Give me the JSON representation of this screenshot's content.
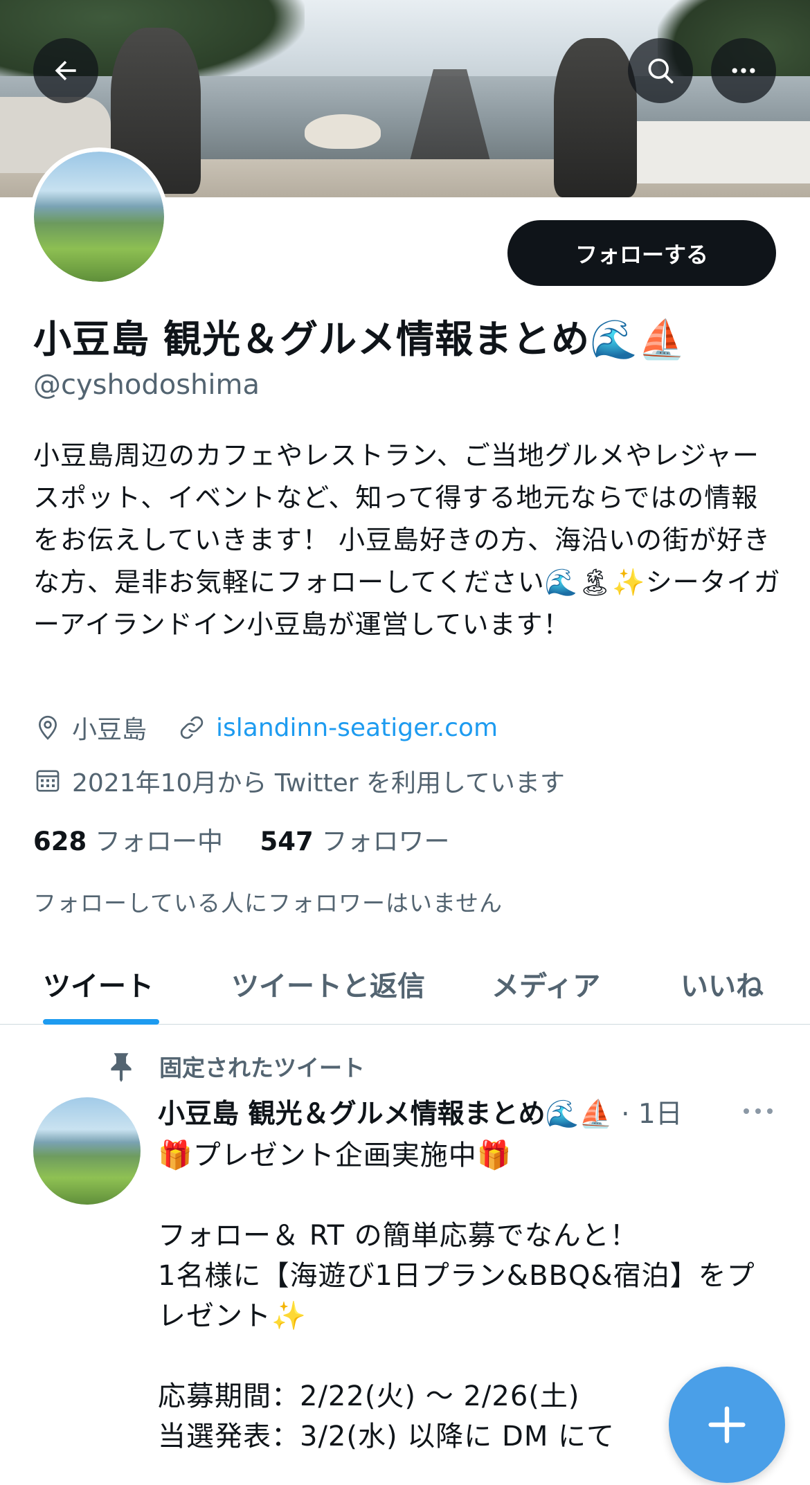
{
  "header": {
    "back_icon": "arrow-left-icon",
    "search_icon": "search-icon",
    "more_icon": "more-horizontal-icon"
  },
  "profile": {
    "follow_label": "フォローする",
    "display_name": "小豆島 観光＆グルメ情報まとめ🌊⛵",
    "handle": "@cyshodoshima",
    "bio": "小豆島周辺のカフェやレストラン、ご当地グルメやレジャースポット、イベントなど、知って得する地元ならではの情報をお伝えしていきます！ 小豆島好きの方、海沿いの街が好きな方、是非お気軽にフォローしてください🌊🏝✨シータイガーアイランドイン小豆島が運営しています！",
    "location": "小豆島",
    "website": "islandinn-seatiger.com",
    "joined": "2021年10月から Twitter を利用しています",
    "following_count": "628",
    "following_label": "フォロー中",
    "followers_count": "547",
    "followers_label": "フォロワー",
    "no_mutual_followers": "フォローしている人にフォロワーはいません"
  },
  "tabs": [
    {
      "label": "ツイート",
      "active": true
    },
    {
      "label": "ツイートと返信",
      "active": false
    },
    {
      "label": "メディア",
      "active": false
    },
    {
      "label": "いいね",
      "active": false
    }
  ],
  "pinned_tweet": {
    "pinned_label": "固定されたツイート",
    "author": "小豆島 観光＆グルメ情報まとめ🌊⛵",
    "time": "· 1日",
    "body": "🎁プレゼント企画実施中🎁\n\nフォロー＆ RT の簡単応募でなんと！\n1名様に【海遊び1日プラン&BBQ&宿泊】をプレゼント✨\n\n応募期間：2/22(火) ～ 2/26(土)\n当選発表：3/2(水) 以降に DM にて"
  },
  "colors": {
    "accent": "#1d9bf0",
    "text_primary": "#0f1419",
    "text_secondary": "#536471",
    "fab": "#4a9fe8"
  },
  "fab": {
    "icon": "plus-icon"
  }
}
